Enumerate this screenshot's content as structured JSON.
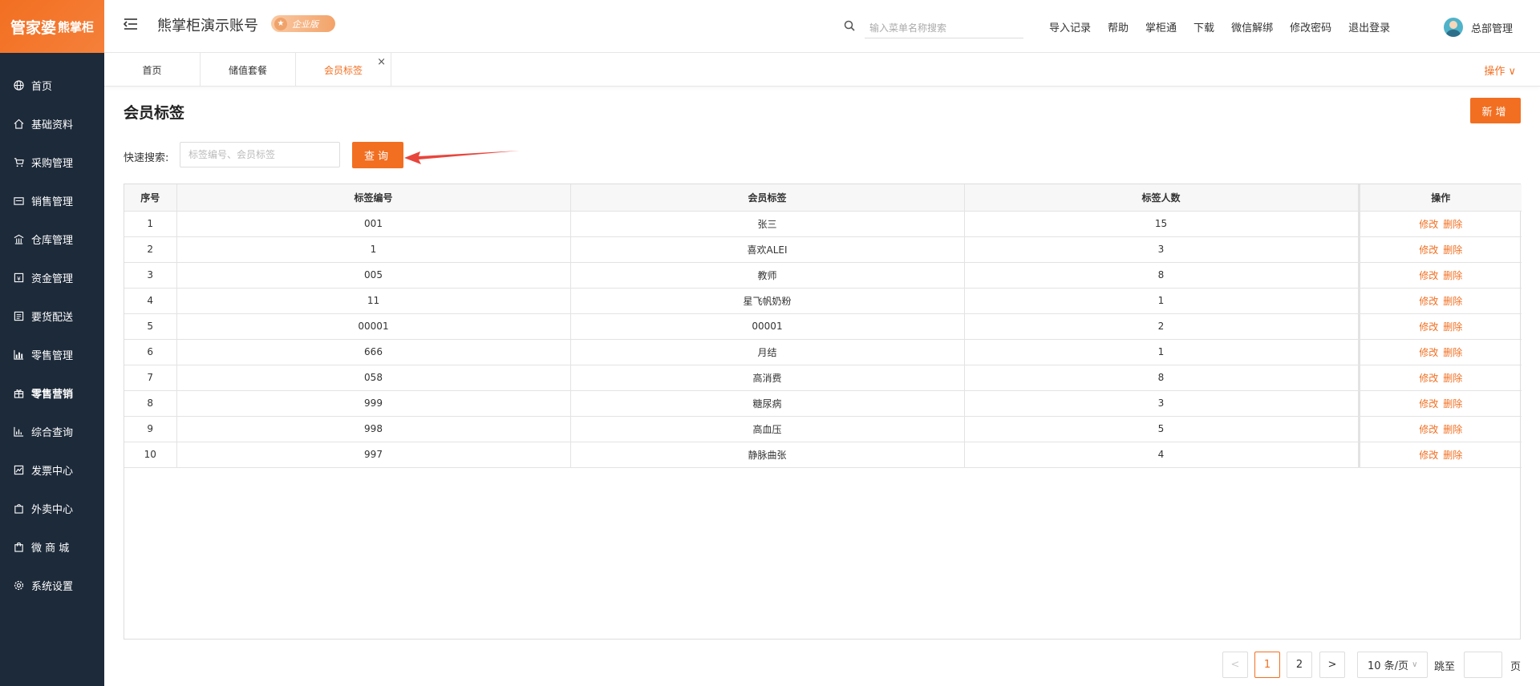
{
  "brand": {
    "logo_main": "管家婆",
    "logo_sub": "熊掌柜"
  },
  "sidebar": {
    "items": [
      {
        "label": "首页",
        "icon": "globe-icon"
      },
      {
        "label": "基础资料",
        "icon": "home-icon"
      },
      {
        "label": "采购管理",
        "icon": "cart-icon"
      },
      {
        "label": "销售管理",
        "icon": "sales-icon"
      },
      {
        "label": "仓库管理",
        "icon": "warehouse-icon"
      },
      {
        "label": "资金管理",
        "icon": "money-icon"
      },
      {
        "label": "要货配送",
        "icon": "list-icon"
      },
      {
        "label": "零售管理",
        "icon": "chart-icon"
      },
      {
        "label": "零售营销",
        "icon": "gift-icon"
      },
      {
        "label": "综合查询",
        "icon": "bar-chart-icon"
      },
      {
        "label": "发票中心",
        "icon": "trend-icon"
      },
      {
        "label": "外卖中心",
        "icon": "delivery-icon"
      },
      {
        "label": "微 商 城",
        "icon": "shop-bag-icon"
      },
      {
        "label": "系统设置",
        "icon": "gear-icon"
      }
    ],
    "active_index": 8
  },
  "header": {
    "account_title": "熊掌柜演示账号",
    "edition_badge": "企业版",
    "search_placeholder": "输入菜单名称搜索",
    "links": [
      "导入记录",
      "帮助",
      "掌柜通",
      "下载",
      "微信解绑",
      "修改密码",
      "退出登录"
    ],
    "user_name": "总部管理"
  },
  "tabs": {
    "items": [
      "首页",
      "储值套餐",
      "会员标签"
    ],
    "active_index": 2,
    "close_symbol": "×",
    "ops_label": "操作 ∨"
  },
  "main": {
    "title": "会员标签",
    "add_label": "新增",
    "quick_search_label": "快速搜索:",
    "quick_search_placeholder": "标签编号、会员标签",
    "query_label": "查询"
  },
  "table": {
    "headers": [
      "序号",
      "标签编号",
      "会员标签",
      "标签人数",
      "操作"
    ],
    "rows": [
      {
        "idx": "1",
        "code": "001",
        "tag": "张三",
        "count": "15"
      },
      {
        "idx": "2",
        "code": "1",
        "tag": "喜欢ALEI",
        "count": "3"
      },
      {
        "idx": "3",
        "code": "005",
        "tag": "教师",
        "count": "8"
      },
      {
        "idx": "4",
        "code": "11",
        "tag": "星飞帆奶粉",
        "count": "1"
      },
      {
        "idx": "5",
        "code": "00001",
        "tag": "00001",
        "count": "2"
      },
      {
        "idx": "6",
        "code": "666",
        "tag": "月结",
        "count": "1"
      },
      {
        "idx": "7",
        "code": "058",
        "tag": "高消费",
        "count": "8"
      },
      {
        "idx": "8",
        "code": "999",
        "tag": "糖尿病",
        "count": "3"
      },
      {
        "idx": "9",
        "code": "998",
        "tag": "高血压",
        "count": "5"
      },
      {
        "idx": "10",
        "code": "997",
        "tag": "静脉曲张",
        "count": "4"
      }
    ],
    "edit_label": "修改",
    "delete_label": "删除"
  },
  "pagination": {
    "prev": "<",
    "pages": [
      "1",
      "2"
    ],
    "current": "1",
    "next": ">",
    "page_size": "10 条/页",
    "jump_label": "跳至",
    "jump_suffix": "页"
  },
  "colors": {
    "accent": "#f26f21",
    "sidebar_bg": "#1d2a3a"
  }
}
